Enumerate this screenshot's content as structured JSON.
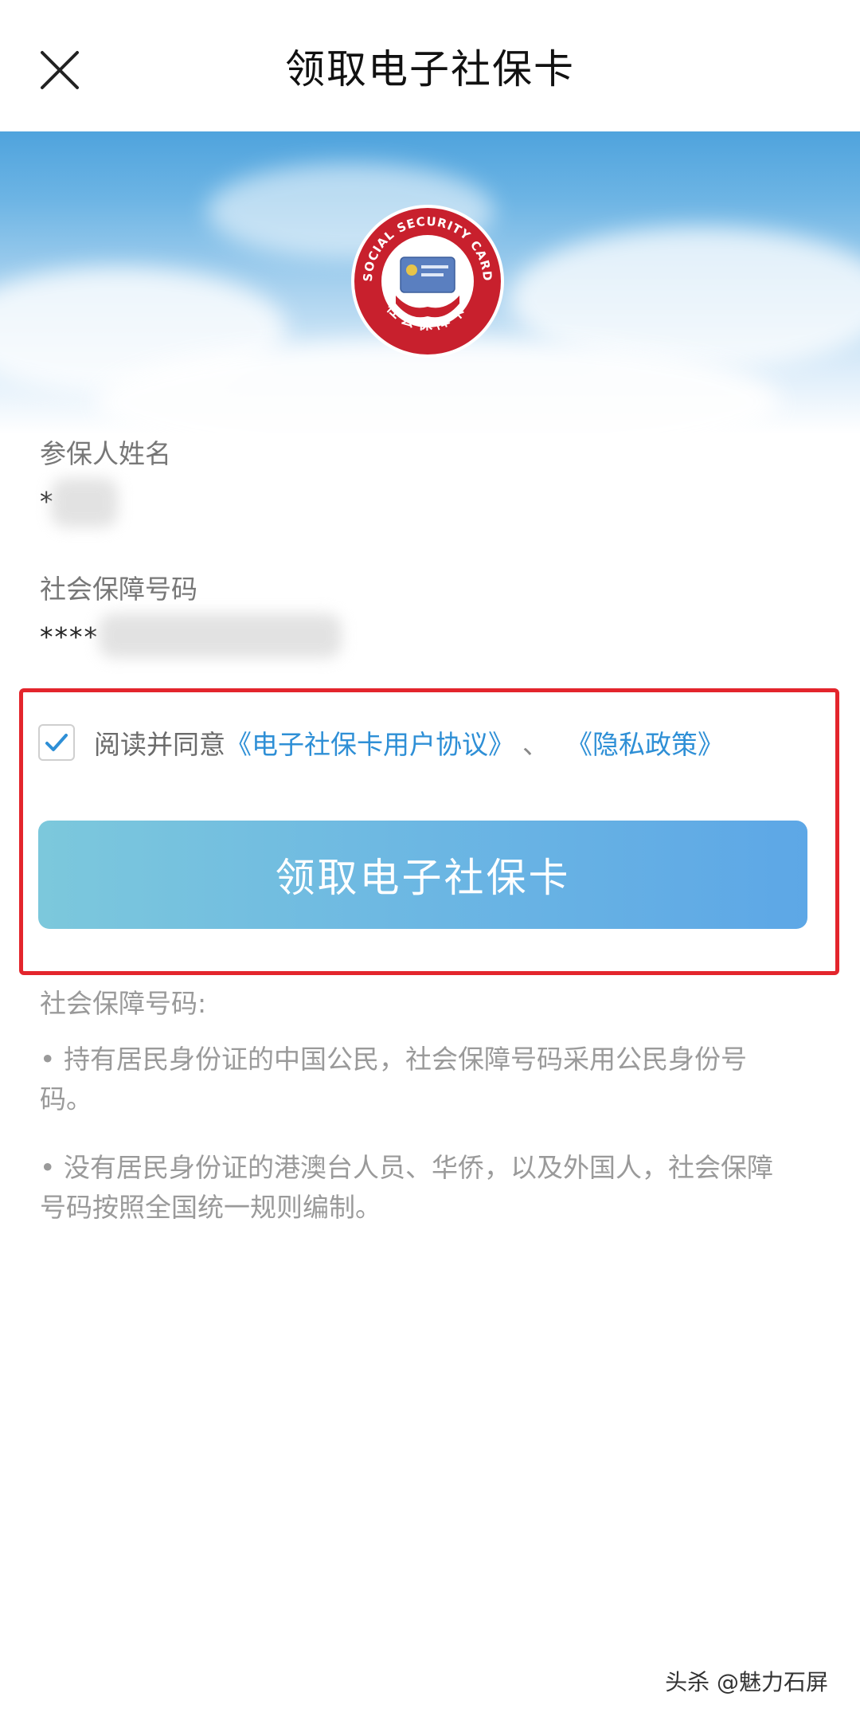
{
  "header": {
    "title": "领取电子社保卡",
    "close_icon": "close-icon"
  },
  "banner": {
    "logo_text_top": "SOCIAL SECURITY CARD",
    "logo_text_bottom": "社会保障卡",
    "colors": {
      "sky": "#4fa3dd",
      "logo_red": "#c8202d"
    }
  },
  "form": {
    "name_label": "参保人姓名",
    "name_value": "*",
    "id_label": "社会保障号码",
    "id_value": "****"
  },
  "agreement": {
    "prefix": "阅读并同意",
    "link_terms": "《电子社保卡用户协议》",
    "separator": "、",
    "link_privacy": "《隐私政策》",
    "checked": true
  },
  "primary_button": {
    "label": "领取电子社保卡"
  },
  "notes": {
    "title": "社会保障号码:",
    "items": [
      "• 持有居民身份证的中国公民，社会保障号码采用公民身份号码。",
      "• 没有居民身份证的港澳台人员、华侨，以及外国人，社会保障号码按照全国统一规则编制。"
    ]
  },
  "watermark": "头杀 @魅力石屏",
  "colors": {
    "link": "#2e8fd6",
    "highlight_border": "#e3252c",
    "button_start": "#7cc8dc",
    "button_end": "#5da7e6"
  }
}
